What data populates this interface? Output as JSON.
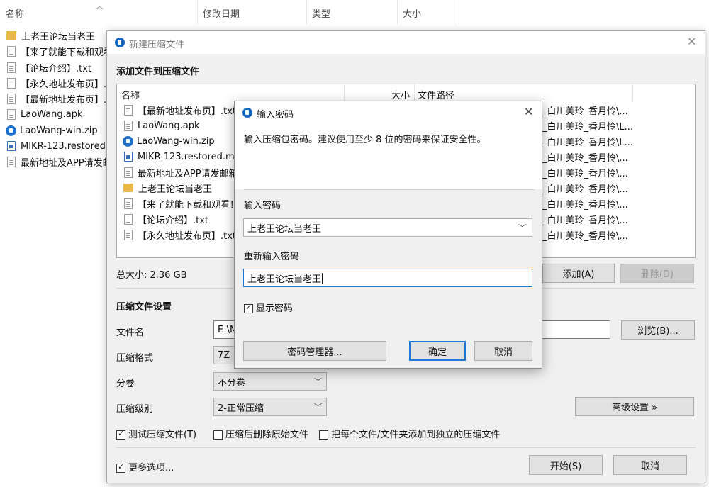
{
  "explorer": {
    "columns": {
      "name": "名称",
      "modified": "修改日期",
      "type": "类型",
      "size": "大小"
    },
    "items": [
      {
        "label": "上老王论坛当老王",
        "icon": "folder-icon"
      },
      {
        "label": "【来了就能下载和观看",
        "icon": "text-file-icon"
      },
      {
        "label": "【论坛介绍】.txt",
        "icon": "text-file-icon"
      },
      {
        "label": "【永久地址发布页】.t",
        "icon": "text-file-icon"
      },
      {
        "label": "【最新地址发布页】.t",
        "icon": "text-file-icon"
      },
      {
        "label": "LaoWang.apk",
        "icon": "file-icon"
      },
      {
        "label": "LaoWang-win.zip",
        "icon": "zip-icon"
      },
      {
        "label": "MIKR-123.restored.m",
        "icon": "video-file-icon"
      },
      {
        "label": "最新地址及APP请发邮",
        "icon": "text-file-icon"
      }
    ]
  },
  "main_dialog": {
    "title": "新建压缩文件",
    "section_add": "添加文件到压缩文件",
    "list": {
      "headers": {
        "name": "名称",
        "size": "大小",
        "path": "文件路径"
      },
      "rows": [
        {
          "name": "【最新地址发布页】.txt",
          "path": "_白川美玲_香月怜\\...",
          "icon": "text-file-icon"
        },
        {
          "name": "LaoWang.apk",
          "path": "_白川美玲_香月怜\\L...",
          "icon": "file-icon"
        },
        {
          "name": "LaoWang-win.zip",
          "path": "_白川美玲_香月怜\\L...",
          "icon": "zip-icon"
        },
        {
          "name": "MIKR-123.restored.mp4",
          "path": "_白川美玲_香月怜\\...",
          "icon": "video-file-icon"
        },
        {
          "name": "最新地址及APP请发邮箱自",
          "path": "_白川美玲_香月怜\\...",
          "icon": "text-file-icon"
        },
        {
          "name": "上老王论坛当老王",
          "path": "_白川美玲_香月怜\\...",
          "icon": "folder-icon"
        },
        {
          "name": "【来了就能下载和观看！给",
          "path": "_白川美玲_香月怜\\...",
          "icon": "text-file-icon"
        },
        {
          "name": "【论坛介绍】.txt",
          "path": "_白川美玲_香月怜\\...",
          "icon": "text-file-icon"
        },
        {
          "name": "【永久地址发布页】.txt",
          "path": "_白川美玲_香月怜\\...",
          "icon": "text-file-icon"
        }
      ]
    },
    "total_size": "总大小: 2.36 GB",
    "add_button": "添加(A)",
    "delete_button": "删除(D)",
    "settings_title": "压缩文件设置",
    "filename_label": "文件名",
    "filename_value": "E:\\M",
    "browse_button": "浏览(B)...",
    "format_label": "压缩格式",
    "format_value": "7Z",
    "volume_label": "分卷",
    "volume_value": "不分卷",
    "level_label": "压缩级别",
    "level_value": "2-正常压缩",
    "advanced_button": "高级设置 »",
    "test_archive": "测试压缩文件(T)",
    "delete_after": "压缩后删除原始文件",
    "separate_archives": "把每个文件/文件夹添加到独立的压缩文件",
    "more_options": "更多选项...",
    "start_button": "开始(S)",
    "cancel_button": "取消"
  },
  "password_dialog": {
    "title": "输入密码",
    "hint": "输入压缩包密码。建议使用至少 8 位的密码来保证安全性。",
    "password_label": "输入密码",
    "password_value": "上老王论坛当老王",
    "confirm_label": "重新输入密码",
    "confirm_value": "上老王论坛当老王",
    "show_password": "显示密码",
    "manager_button": "密码管理器...",
    "ok_button": "确定",
    "cancel_button": "取消"
  }
}
